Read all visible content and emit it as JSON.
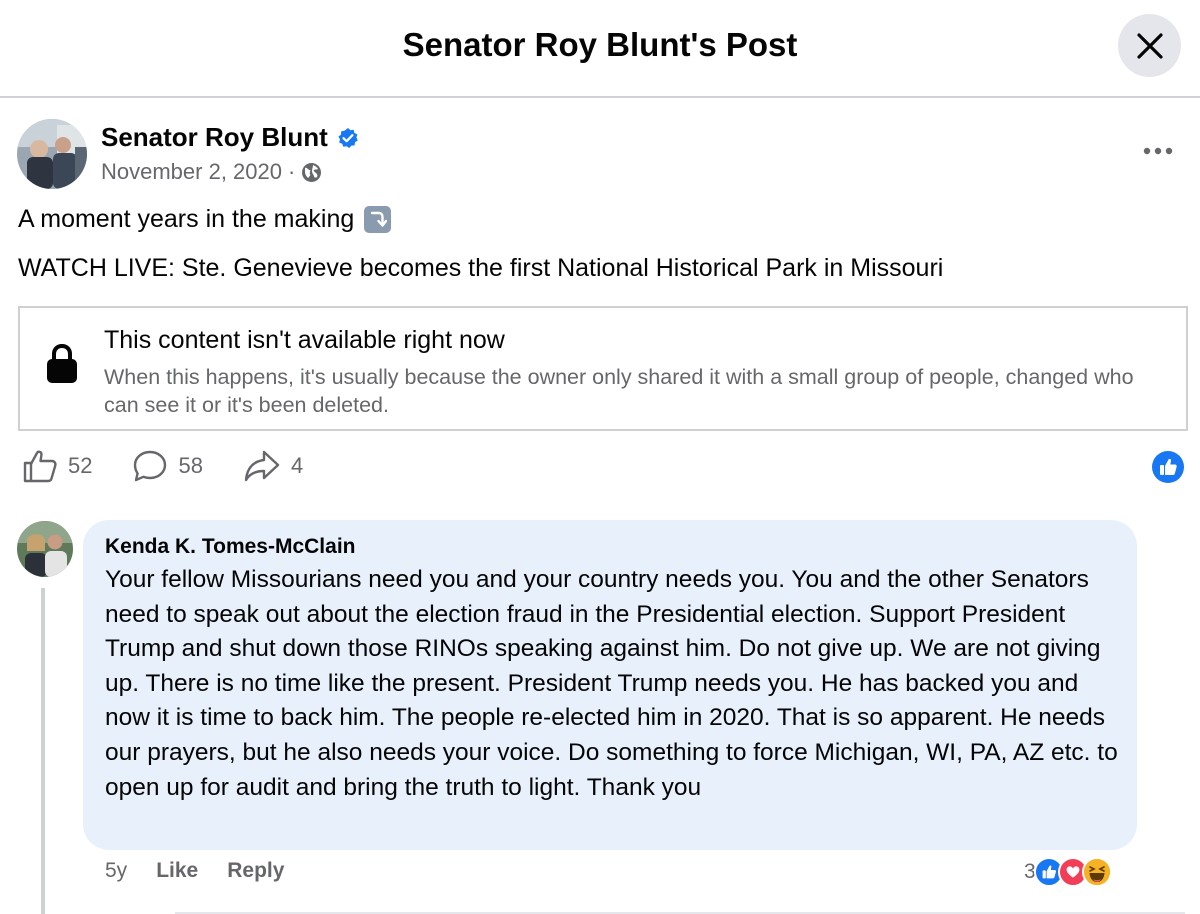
{
  "header": {
    "title": "Senator Roy Blunt's Post"
  },
  "post": {
    "author": "Senator Roy Blunt",
    "date": "November 2, 2020",
    "separator": "·",
    "line1": "A moment years in the making",
    "line2": "WATCH LIVE: Ste. Genevieve becomes the first National Historical Park in Missouri",
    "unavailable": {
      "title": "This content isn't available right now",
      "message": "When this happens, it's usually because the owner only shared it with a small group of people, changed who can see it or it's been deleted."
    },
    "stats": {
      "likes": "52",
      "comments": "58",
      "shares": "4"
    }
  },
  "comment": {
    "author": "Kenda K. Tomes-McClain",
    "text": "Your fellow Missourians need you and your country needs you. You and the other Senators need to speak out about the election fraud in the Presidential election. Support President Trump and shut down those RINOs speaking against him. Do not give up. We are not giving up. There is no time like the present. President Trump needs you. He has backed you and now it is time to back him. The people re-elected him in 2020. That is so apparent. He needs our prayers, but he also needs your voice. Do something to force Michigan, WI, PA, AZ etc. to open up for audit and bring the truth to light. Thank you",
    "age": "5y",
    "like_label": "Like",
    "reply_label": "Reply",
    "reaction_count": "3",
    "reactions": [
      "like-icon",
      "love-icon",
      "haha-icon"
    ]
  },
  "colors": {
    "accent": "#1877f2",
    "bubble": "#e7f0fb",
    "secondary_text": "#65676b"
  }
}
